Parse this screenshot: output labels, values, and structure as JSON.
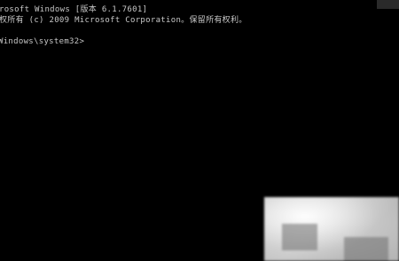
{
  "console": {
    "line1": "rosoft Windows [版本 6.1.7601]",
    "line2": "权所有 (c) 2009 Microsoft Corporation。保留所有权利。",
    "line3": "Windows\\system32>"
  },
  "colors": {
    "background": "#000000",
    "text": "#c8c8c8"
  }
}
